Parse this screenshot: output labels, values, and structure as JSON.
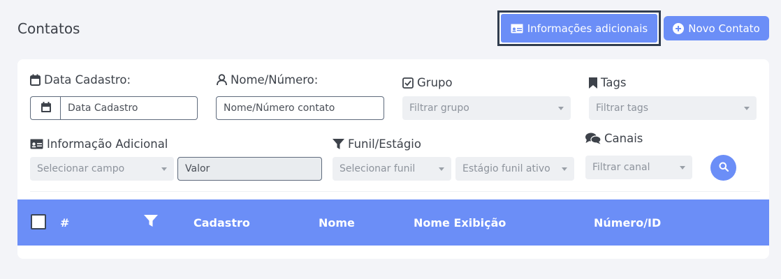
{
  "page": {
    "title": "Contatos"
  },
  "toolbar": {
    "info_button": "Informações adicionais",
    "new_contact_button": "Novo Contato"
  },
  "filters": {
    "date": {
      "label": "Data Cadastro:",
      "placeholder": "Data Cadastro"
    },
    "name": {
      "label": "Nome/Número:",
      "placeholder": "Nome/Número contato"
    },
    "group": {
      "label": "Grupo",
      "placeholder": "Filtrar grupo"
    },
    "tags": {
      "label": "Tags",
      "placeholder": "Filtrar tags"
    },
    "extra": {
      "label": "Informação Adicional",
      "field_placeholder": "Selecionar campo",
      "value_placeholder": "Valor"
    },
    "funnel": {
      "label": "Funil/Estágio",
      "funnel_placeholder": "Selecionar funil",
      "stage_placeholder": "Estágio funil ativo"
    },
    "channels": {
      "label": "Canais",
      "placeholder": "Filtrar canal"
    }
  },
  "table": {
    "columns": [
      "#",
      "Cadastro",
      "Nome",
      "Nome Exibição",
      "Número/ID"
    ]
  },
  "colors": {
    "accent": "#6b8ef7",
    "text": "#3c4048",
    "frame": "#313d4f"
  }
}
